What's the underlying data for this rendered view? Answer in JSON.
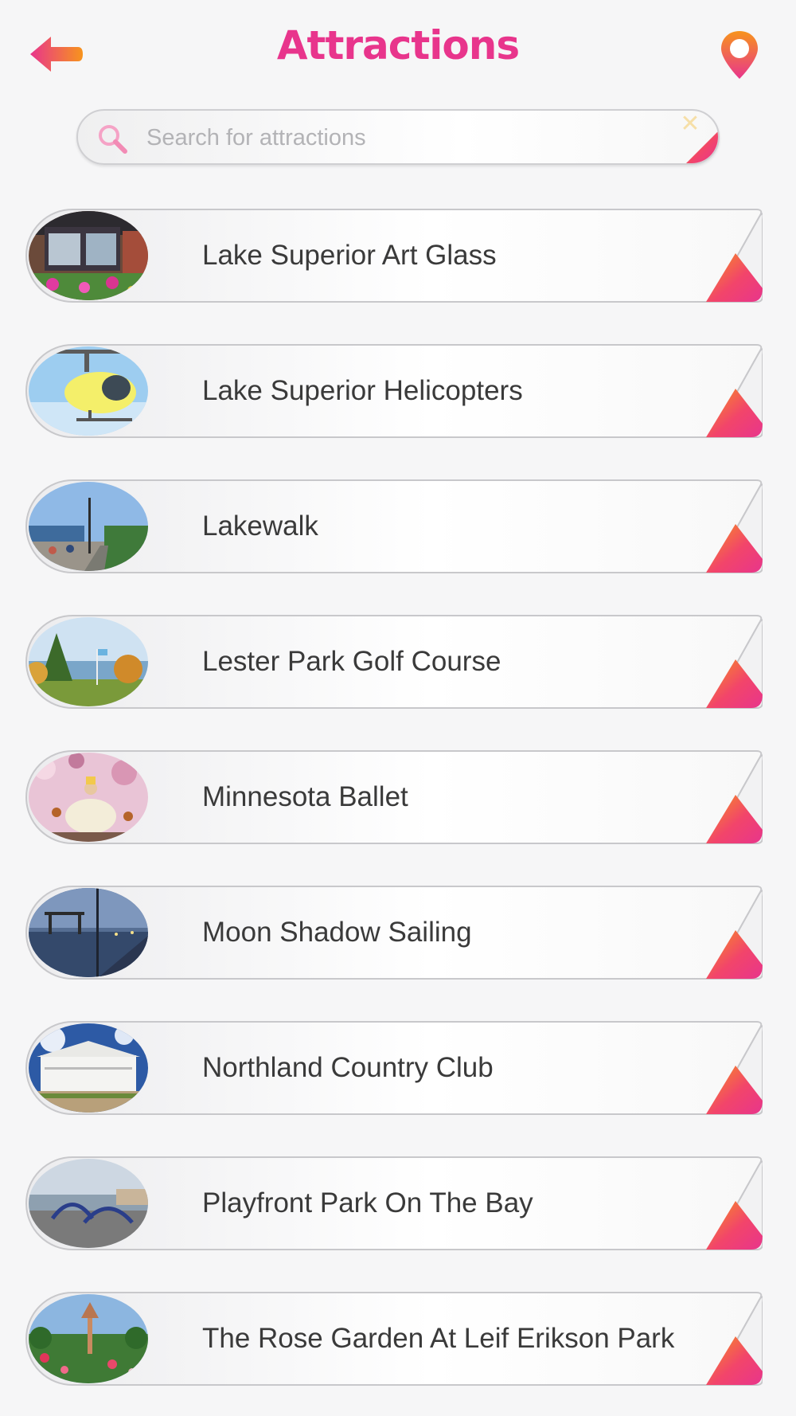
{
  "header": {
    "title": "Attractions",
    "back_icon": "arrow-left-icon",
    "map_icon": "map-pin-icon",
    "accent_color": "#e8358c",
    "arrow_color": "#f36b3b"
  },
  "search": {
    "placeholder": "Search for attractions",
    "value": "",
    "clear_label": "✕"
  },
  "attractions": [
    {
      "label": "Lake Superior Art Glass",
      "image": "storefront-photo"
    },
    {
      "label": "Lake Superior Helicopters",
      "image": "helicopter-photo"
    },
    {
      "label": "Lakewalk",
      "image": "lakewalk-photo"
    },
    {
      "label": "Lester Park Golf Course",
      "image": "golf-course-photo"
    },
    {
      "label": "Minnesota Ballet",
      "image": "ballet-photo"
    },
    {
      "label": "Moon Shadow Sailing",
      "image": "harbor-photo"
    },
    {
      "label": "Northland Country Club",
      "image": "clubhouse-photo"
    },
    {
      "label": "Playfront Park On The Bay",
      "image": "playground-photo"
    },
    {
      "label": "The Rose Garden At Leif Erikson Park",
      "image": "rose-garden-photo"
    }
  ]
}
